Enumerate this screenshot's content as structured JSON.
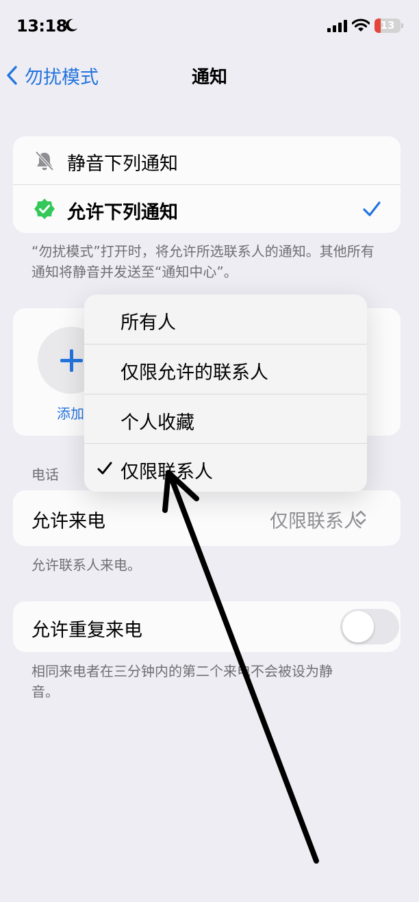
{
  "status_bar": {
    "time": "13:18",
    "battery": "13"
  },
  "nav": {
    "back_label": "勿扰模式",
    "title": "通知"
  },
  "notify_options": {
    "silence_label": "静音下列通知",
    "allow_label": "允许下列通知",
    "footnote": "“勿扰模式”打开时，将允许所选联系人的通知。其他所有通知将静音并发送至“通知中心”。"
  },
  "people": {
    "add_label": "添加"
  },
  "calls": {
    "section_header": "电话",
    "allow_calls_label": "允许来电",
    "allow_calls_value": "仅限联系人",
    "footnote": "允许联系人来电。",
    "repeated_calls_label": "允许重复来电",
    "repeated_calls_enabled": false,
    "repeated_footnote": "相同来电者在三分钟内的第二个来电不会被设为静音。"
  },
  "menu": {
    "items": [
      "所有人",
      "仅限允许的联系人",
      "个人收藏",
      "仅限联系人"
    ],
    "selected_index": 3
  },
  "colors": {
    "accent": "#2374de",
    "allowed_badge": "#34c759",
    "battery_low": "#e5463c"
  },
  "icons": [
    "moon-icon",
    "cellular-signal-icon",
    "wifi-icon",
    "battery-icon",
    "chevron-left-icon",
    "bell-slash-icon",
    "check-badge-icon",
    "checkmark-icon",
    "plus-icon",
    "chevron-updown-icon",
    "arrow-annotation"
  ]
}
